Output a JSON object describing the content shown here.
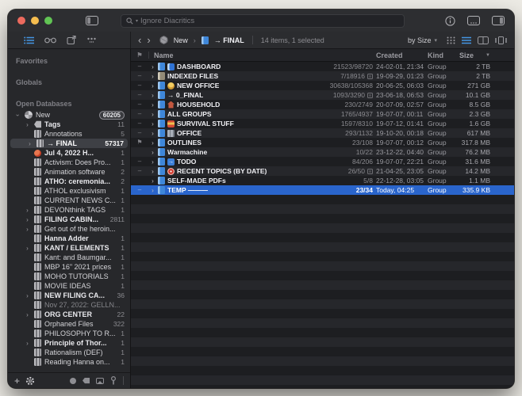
{
  "titlebar": {
    "search_placeholder": "Ignore Diacritics"
  },
  "toolbar": {
    "breadcrumb": {
      "database": "New",
      "group": "→ FINAL"
    },
    "status": "14 items, 1 selected",
    "sort_label": "by Size"
  },
  "glyphs": {
    "disclosure": "›",
    "back": "‹",
    "forward": "›",
    "crumb_sep": "›",
    "dropdown": "▾",
    "sort_desc": "▼",
    "minus": "–",
    "flag": "⚑",
    "plus": "+",
    "todo_arrow": "→"
  },
  "colors": {
    "selection_blue": "#2a65cc",
    "folder_blue": "#3f87d9",
    "accent_blue": "#4596e3"
  },
  "sidebar": {
    "rows": [
      {
        "type": "section",
        "label": "Favorites"
      },
      {
        "type": "section",
        "label": "Globals"
      },
      {
        "type": "section",
        "label": "Open Databases"
      },
      {
        "type": "item",
        "indent": 0,
        "expander": "open",
        "icon": "icon-db",
        "label": "New",
        "count": "60205",
        "pill": true
      },
      {
        "type": "item",
        "indent": 1,
        "expander": "closed",
        "icon": "icon-tag",
        "label": "Tags",
        "count": "11",
        "bold": true
      },
      {
        "type": "item",
        "indent": 1,
        "icon": "icon-group",
        "label": "Annotations",
        "count": "5"
      },
      {
        "type": "item",
        "indent": 1,
        "expander": "closed",
        "icon": "icon-group",
        "label": "→ FINAL",
        "count": "57317",
        "bold": true,
        "selected": true
      },
      {
        "type": "item",
        "indent": 1,
        "icon": "icon-red",
        "label": "Jul 4, 2022 H...",
        "count": "1",
        "bold": true
      },
      {
        "type": "item",
        "indent": 1,
        "icon": "icon-group",
        "label": "Activism: Does Pro...",
        "count": "1"
      },
      {
        "type": "item",
        "indent": 1,
        "icon": "icon-group",
        "label": "Animation software",
        "count": "2"
      },
      {
        "type": "item",
        "indent": 1,
        "icon": "icon-group",
        "label": "ATHO: ceremonia...",
        "count": "2",
        "bold": true
      },
      {
        "type": "item",
        "indent": 1,
        "icon": "icon-group",
        "label": "ATHOL exclusivism",
        "count": "1"
      },
      {
        "type": "item",
        "indent": 1,
        "icon": "icon-group",
        "label": "CURRENT NEWS C...",
        "count": "1"
      },
      {
        "type": "item",
        "indent": 1,
        "expander": "closed",
        "icon": "icon-group",
        "label": "DEVONthink TAGS",
        "count": "1"
      },
      {
        "type": "item",
        "indent": 1,
        "expander": "closed",
        "icon": "icon-group",
        "label": "FILING CABIN...",
        "count": "2811",
        "bold": true
      },
      {
        "type": "item",
        "indent": 1,
        "expander": "closed",
        "icon": "icon-group",
        "label": "Get out of the heroin...",
        "count": ""
      },
      {
        "type": "item",
        "indent": 1,
        "icon": "icon-group",
        "label": "Hanna Adder",
        "count": "1",
        "bold": true
      },
      {
        "type": "item",
        "indent": 1,
        "expander": "closed",
        "icon": "icon-group",
        "label": "KANT / ELEMENTS",
        "count": "1",
        "bold": true
      },
      {
        "type": "item",
        "indent": 1,
        "icon": "icon-group",
        "label": "Kant: and Baumgar...",
        "count": "1"
      },
      {
        "type": "item",
        "indent": 1,
        "icon": "icon-group",
        "label": "MBP 16\" 2021 prices",
        "count": "1"
      },
      {
        "type": "item",
        "indent": 1,
        "icon": "icon-group",
        "label": "MOHO TUTORIALS",
        "count": "1"
      },
      {
        "type": "item",
        "indent": 1,
        "icon": "icon-group",
        "label": "MOVIE IDEAS",
        "count": "1"
      },
      {
        "type": "item",
        "indent": 1,
        "expander": "closed",
        "icon": "icon-group",
        "label": "NEW FILING CA...",
        "count": "36",
        "bold": true
      },
      {
        "type": "item",
        "indent": 1,
        "icon": "icon-group",
        "label": "Nov 27, 2022: GELLN...",
        "count": "",
        "dimmed": true
      },
      {
        "type": "item",
        "indent": 1,
        "expander": "closed",
        "icon": "icon-group",
        "label": "ORG CENTER",
        "count": "22",
        "bold": true
      },
      {
        "type": "item",
        "indent": 1,
        "icon": "icon-group",
        "label": "Orphaned Files",
        "count": "322"
      },
      {
        "type": "item",
        "indent": 1,
        "icon": "icon-group",
        "label": "PHILOSOPHY TO R...",
        "count": "1"
      },
      {
        "type": "item",
        "indent": 1,
        "expander": "closed",
        "icon": "icon-group",
        "label": "Principle of Thor...",
        "count": "1",
        "bold": true
      },
      {
        "type": "item",
        "indent": 1,
        "icon": "icon-group",
        "label": "Rationalism (DEF)",
        "count": "1"
      },
      {
        "type": "item",
        "indent": 1,
        "icon": "icon-group",
        "label": "Reading Hanna on...",
        "count": "1"
      }
    ]
  },
  "list": {
    "columns": [
      "Name",
      "Created",
      "Kind",
      "Size"
    ],
    "rows": [
      {
        "flag": "minus",
        "badge": "dashboard",
        "badge_name": "dashboard-badge-icon",
        "name": "DASHBOARD",
        "count": "21523/98720",
        "created": "24-02-01, 21:34",
        "kind": "Group",
        "size": "2 TB",
        "folder": "blue"
      },
      {
        "flag": "minus",
        "name": "INDEXED FILES",
        "count": "7/18916",
        "count_icon": true,
        "created": "19-09-29, 01:23",
        "kind": "Group",
        "size": "2 TB",
        "folder": "tan"
      },
      {
        "flag": "minus",
        "badge": "person",
        "badge_name": "person-badge-icon",
        "name": "NEW OFFICE",
        "count": "30638/105368",
        "created": "20-06-25, 06:03",
        "kind": "Group",
        "size": "271 GB",
        "folder": "blue"
      },
      {
        "flag": "minus",
        "name": "→ 0_FINAL",
        "count": "1093/3290",
        "count_icon": true,
        "created": "23-06-18, 06:53",
        "kind": "Group",
        "size": "10.1 GB",
        "folder": "blue"
      },
      {
        "flag": "minus",
        "badge": "house",
        "badge_name": "house-badge-icon",
        "name": "HOUSEHOLD",
        "count": "230/2749",
        "created": "20-07-09, 02:57",
        "kind": "Group",
        "size": "8.5 GB",
        "folder": "blue"
      },
      {
        "flag": "minus",
        "name": "ALL GROUPS",
        "count": "1765/4937",
        "created": "19-07-07, 00:11",
        "kind": "Group",
        "size": "2.3 GB",
        "folder": "blue"
      },
      {
        "flag": "minus",
        "badge": "survival",
        "badge_name": "survival-badge-icon",
        "name": "SURVIVAL STUFF",
        "count": "1597/8310",
        "created": "19-07-12, 01:41",
        "kind": "Group",
        "size": "1.6 GB",
        "folder": "blue"
      },
      {
        "flag": "minus",
        "badge": "building",
        "badge_name": "office-badge-icon",
        "name": "OFFICE",
        "count": "293/1132",
        "created": "19-10-20, 00:18",
        "kind": "Group",
        "size": "617 MB",
        "folder": "blue"
      },
      {
        "flag": "flag",
        "name": "OUTLINES",
        "count": "23/108",
        "created": "19-07-07, 00:12",
        "kind": "Group",
        "size": "317.8 MB",
        "folder": "blue"
      },
      {
        "name": "Warmachine",
        "count": "10/22",
        "created": "23-12-22, 04:40",
        "kind": "Group",
        "size": "76.2 MB",
        "folder": "blue"
      },
      {
        "flag": "minus",
        "badge": "todo",
        "badge_name": "arrow-badge-icon",
        "name": "TODO",
        "count": "84/206",
        "created": "19-07-07, 22:21",
        "kind": "Group",
        "size": "31.6 MB",
        "folder": "blue"
      },
      {
        "flag": "minus",
        "badge": "target",
        "badge_name": "target-badge-icon",
        "name": "RECENT TOPICS (BY DATE)",
        "count": "26/50",
        "count_icon": true,
        "created": "21-04-25, 23:05",
        "kind": "Group",
        "size": "14.2 MB",
        "folder": "blue"
      },
      {
        "name": "SELF-MADE PDFs",
        "count": "5/8",
        "created": "22-12-28, 03:05",
        "kind": "Group",
        "size": "1.1 MB",
        "folder": "blue"
      },
      {
        "flag": "minus",
        "name": "TEMP ———",
        "count": "23/34",
        "created": "Today, 04:25",
        "kind": "Group",
        "size": "335.9 KB",
        "folder": "blue",
        "selected": true
      }
    ]
  }
}
